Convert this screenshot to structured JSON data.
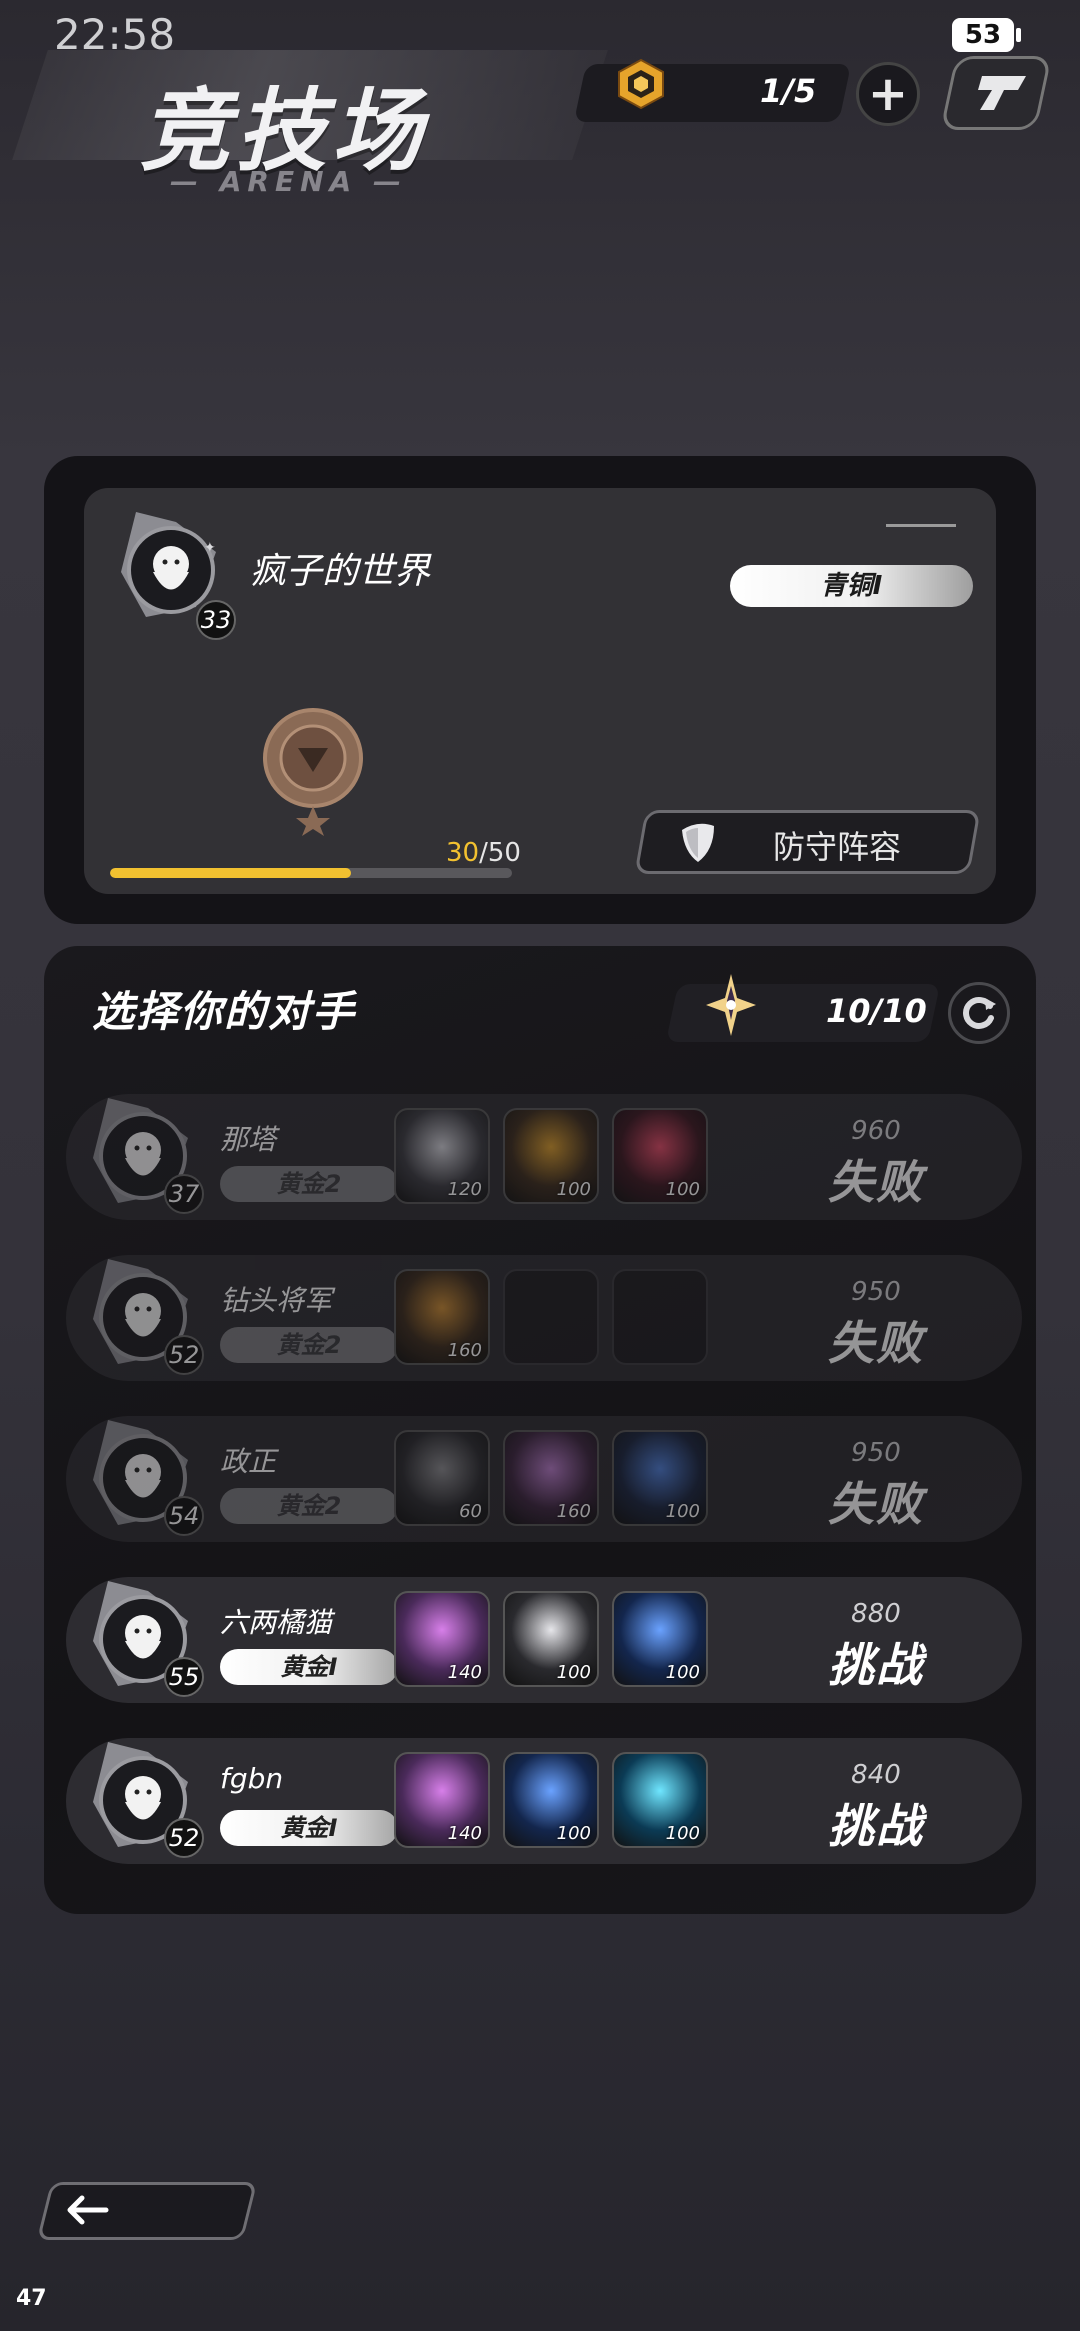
{
  "status_bar": {
    "time": "22:58",
    "battery": "53"
  },
  "header": {
    "title": "竞技场",
    "subtitle": "— ARENA —",
    "tickets": "1/5"
  },
  "profile": {
    "name": "疯子的世界",
    "level": "33",
    "rank": "青铜I",
    "progress_current": "30",
    "progress_total": "/50",
    "progress_fraction": 0.6,
    "defense_label": "防守阵容"
  },
  "opponents_section": {
    "title": "选择你的对手",
    "challenges": "10/10"
  },
  "opponents": [
    {
      "name": "那塔",
      "level": "37",
      "rank": "黄金2",
      "score": "960",
      "action": "失败",
      "defeated": true,
      "heroes": [
        {
          "lv": "120",
          "color": "#3a3a40",
          "accent": "#cfcfd6"
        },
        {
          "lv": "100",
          "color": "#3b2b1c",
          "accent": "#d79a2b"
        },
        {
          "lv": "100",
          "color": "#3b1620",
          "accent": "#e04a66"
        }
      ]
    },
    {
      "name": "钻头将军",
      "level": "52",
      "rank": "黄金2",
      "score": "950",
      "action": "失败",
      "defeated": true,
      "heroes": [
        {
          "lv": "160",
          "color": "#3b2b1c",
          "accent": "#c98a33"
        },
        {
          "lv": "",
          "color": "",
          "accent": ""
        },
        {
          "lv": "",
          "color": "",
          "accent": ""
        }
      ]
    },
    {
      "name": "政正",
      "level": "54",
      "rank": "黄金2",
      "score": "950",
      "action": "失败",
      "defeated": true,
      "heroes": [
        {
          "lv": "60",
          "color": "#2b2b2f",
          "accent": "#8b8b8f"
        },
        {
          "lv": "160",
          "color": "#3d2640",
          "accent": "#b77bc9"
        },
        {
          "lv": "100",
          "color": "#1b2640",
          "accent": "#4f7ed6"
        }
      ]
    },
    {
      "name": "六两橘猫",
      "level": "55",
      "rank": "黄金I",
      "score": "880",
      "action": "挑战",
      "defeated": false,
      "heroes": [
        {
          "lv": "140",
          "color": "#4a2a5a",
          "accent": "#d77fe9"
        },
        {
          "lv": "100",
          "color": "#2a2a2e",
          "accent": "#e6e6ea"
        },
        {
          "lv": "100",
          "color": "#13264d",
          "accent": "#6aa2ff"
        }
      ]
    },
    {
      "name": "fgbn",
      "level": "52",
      "rank": "黄金I",
      "score": "840",
      "action": "挑战",
      "defeated": false,
      "heroes": [
        {
          "lv": "140",
          "color": "#4a2a5a",
          "accent": "#d77fe9"
        },
        {
          "lv": "100",
          "color": "#13264d",
          "accent": "#6aa2ff"
        },
        {
          "lv": "100",
          "color": "#0b3b55",
          "accent": "#6fe6ff"
        }
      ]
    }
  ],
  "debug": {
    "fps": "47"
  },
  "colors": {
    "progress": "#f2c130",
    "panel": "#141317",
    "card": "#323135"
  },
  "icons": [
    "ticket-icon",
    "plus-icon",
    "logo-icon",
    "rank-medal-icon",
    "shield-icon",
    "star-icon",
    "refresh-icon",
    "back-arrow-icon"
  ]
}
